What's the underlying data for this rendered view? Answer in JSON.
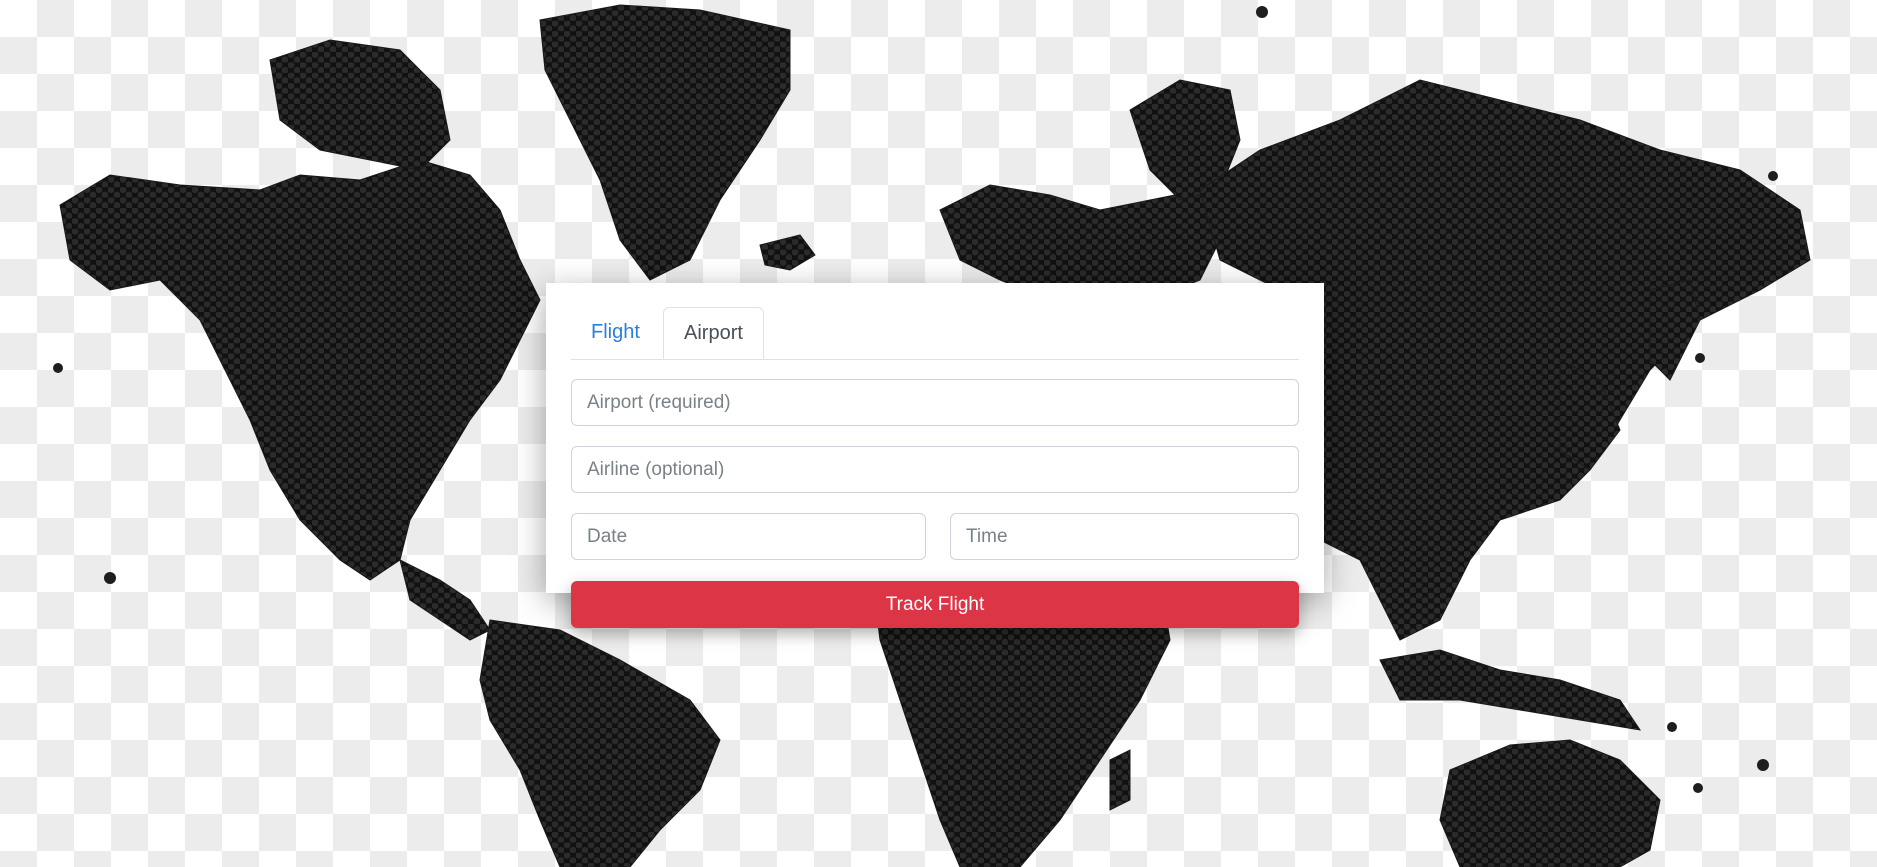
{
  "tabs": {
    "flight": "Flight",
    "airport": "Airport",
    "active": "airport"
  },
  "form": {
    "airport_placeholder": "Airport (required)",
    "airline_placeholder": "Airline (optional)",
    "date_placeholder": "Date",
    "time_placeholder": "Time",
    "submit_label": "Track Flight"
  },
  "colors": {
    "accent_link": "#2a7ee0",
    "submit_button": "#dc3545",
    "map_land": "#1e1e1e"
  },
  "background": {
    "type": "hexagonal dot world map on checkerboard"
  }
}
